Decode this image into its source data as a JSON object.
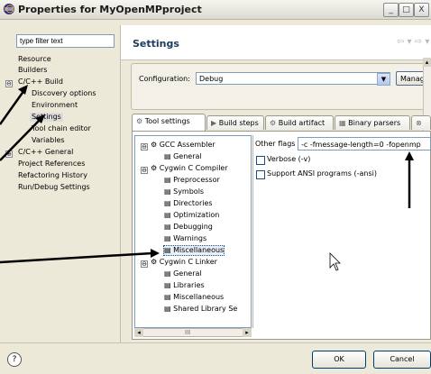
{
  "window": {
    "title": "Properties for MyOpenMPproject",
    "minimize": "_",
    "maximize": "□",
    "close": "X"
  },
  "filter": {
    "value": "type filter text"
  },
  "tree": [
    {
      "label": "Resource"
    },
    {
      "label": "Builders"
    },
    {
      "label": "C/C++ Build",
      "expander": "⊖"
    },
    {
      "label": "Discovery options"
    },
    {
      "label": "Environment"
    },
    {
      "label": "Settings"
    },
    {
      "label": "Tool chain editor"
    },
    {
      "label": "Variables"
    },
    {
      "label": "C/C++ General",
      "expander": "⊕"
    },
    {
      "label": "Project References"
    },
    {
      "label": "Refactoring History"
    },
    {
      "label": "Run/Debug Settings"
    }
  ],
  "header": {
    "title": "Settings",
    "nav": "⇦ ▾ ⇨ ▾"
  },
  "config": {
    "label": "Configuration:",
    "value": "Debug",
    "arrow": "▼",
    "manage": "Manage"
  },
  "tabs": [
    {
      "label": "Tool settings",
      "icon": "⚙"
    },
    {
      "label": "Build steps",
      "icon": "▶"
    },
    {
      "label": "Build artifact",
      "icon": "⚙"
    },
    {
      "label": "Binary parsers",
      "icon": "▦"
    },
    {
      "label": "",
      "icon": "⊗"
    }
  ],
  "tool_tree": [
    {
      "label": "GCC Assembler",
      "icon": "⚙",
      "expander": "⊖"
    },
    {
      "label": "General",
      "icon": "▤"
    },
    {
      "label": "Cygwin C Compiler",
      "icon": "⚙",
      "expander": "⊖"
    },
    {
      "label": "Preprocessor",
      "icon": "▤"
    },
    {
      "label": "Symbols",
      "icon": "▤"
    },
    {
      "label": "Directories",
      "icon": "▤"
    },
    {
      "label": "Optimization",
      "icon": "▤"
    },
    {
      "label": "Debugging",
      "icon": "▤"
    },
    {
      "label": "Warnings",
      "icon": "▤"
    },
    {
      "label": "Miscellaneous",
      "icon": "▤"
    },
    {
      "label": "Cygwin C Linker",
      "icon": "⚙",
      "expander": "⊖"
    },
    {
      "label": "General",
      "icon": "▤"
    },
    {
      "label": "Libraries",
      "icon": "▤"
    },
    {
      "label": "Miscellaneous",
      "icon": "▤"
    },
    {
      "label": "Shared Library Se",
      "icon": "▤"
    }
  ],
  "options": {
    "other_flags_label": "Other flags",
    "other_flags_value": "-c -fmessage-length=0 -fopenmp",
    "verbose": "Verbose (-v)",
    "ansi": "Support ANSI programs (-ansi)"
  },
  "scroll": {
    "left": "◂",
    "right": "▸",
    "up": "▴",
    "down": "▾",
    "thumb": "III"
  },
  "footer": {
    "help": "?",
    "ok": "OK",
    "cancel": "Cancel"
  },
  "colors": {
    "selection_bg": "#dcdcdc",
    "panel_bg": "#ece9d8",
    "tree_selection_border": "#1c5180"
  }
}
